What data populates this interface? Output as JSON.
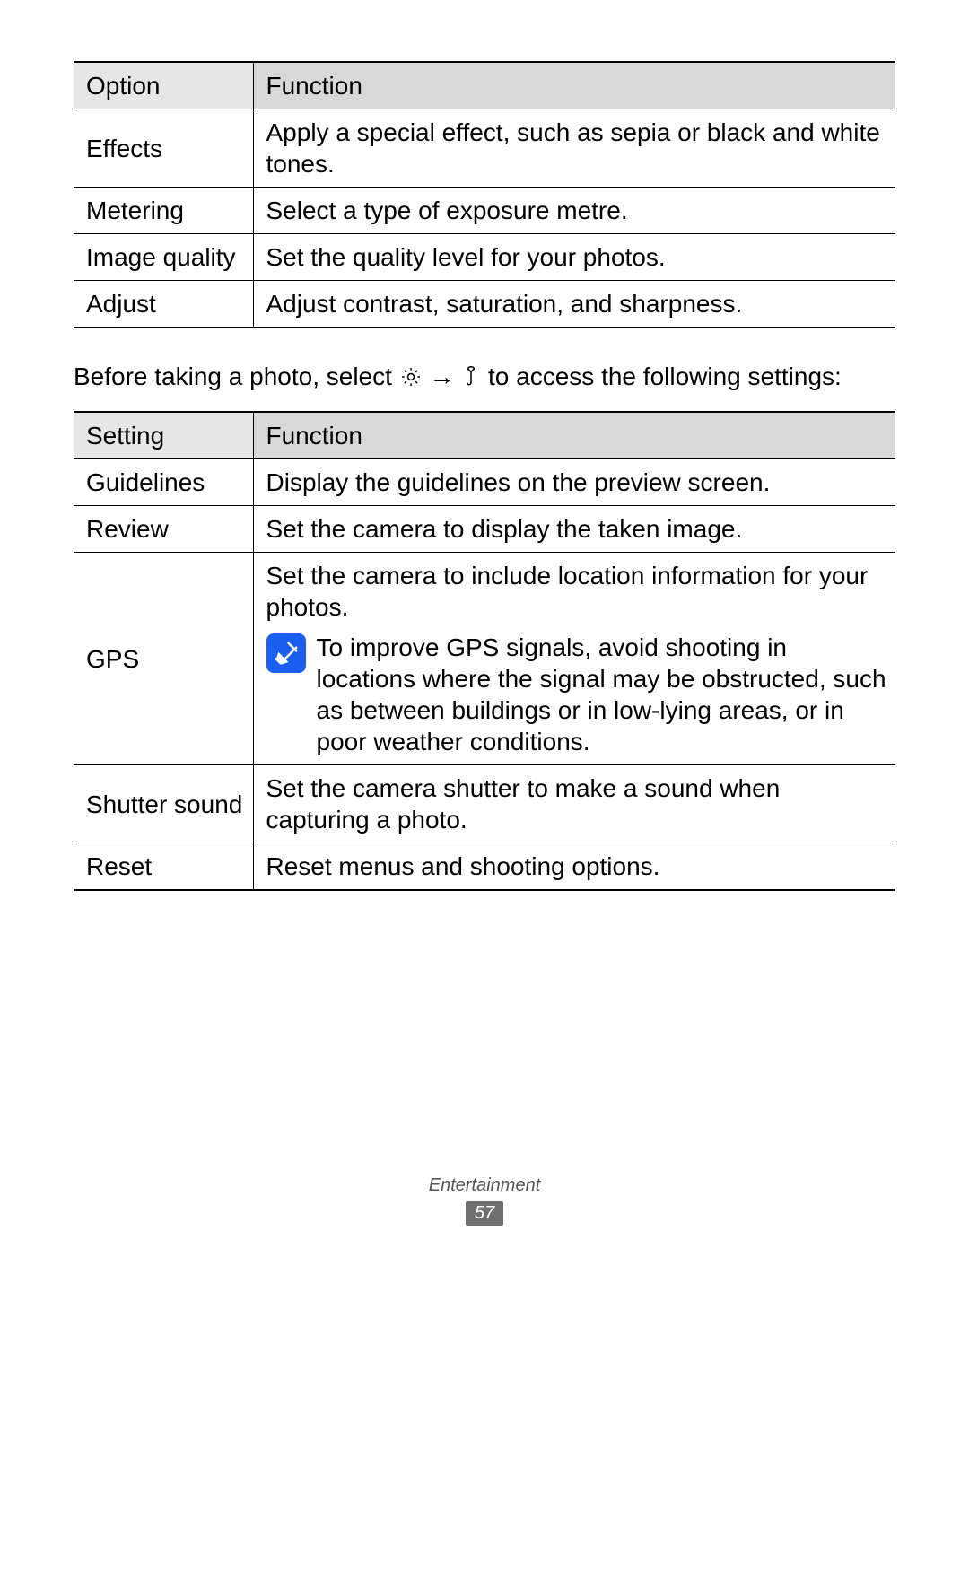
{
  "table1": {
    "header": {
      "col1": "Option",
      "col2": "Function"
    },
    "rows": [
      {
        "opt": "Effects",
        "fn": "Apply a special effect, such as sepia or black and white tones."
      },
      {
        "opt": "Metering",
        "fn": "Select a type of exposure metre."
      },
      {
        "opt": "Image quality",
        "fn": "Set the quality level for your photos."
      },
      {
        "opt": "Adjust",
        "fn": "Adjust contrast, saturation, and sharpness."
      }
    ]
  },
  "mid": {
    "pre": "Before taking a photo, select ",
    "arrow": " → ",
    "post": " to access the following settings:"
  },
  "table2": {
    "header": {
      "col1": "Setting",
      "col2": "Function"
    },
    "rows": {
      "guidelines": {
        "opt": "Guidelines",
        "fn": "Display the guidelines on the preview screen."
      },
      "review": {
        "opt": "Review",
        "fn": "Set the camera to display the taken image."
      },
      "gps": {
        "opt": "GPS",
        "fn": "Set the camera to include location information for your photos.",
        "note": "To improve GPS signals, avoid shooting in locations where the signal may be obstructed, such as between buildings or in low-lying areas, or in poor weather conditions."
      },
      "shutter": {
        "opt": "Shutter sound",
        "fn": "Set the camera shutter to make a sound when capturing a photo."
      },
      "reset": {
        "opt": "Reset",
        "fn": "Reset menus and shooting options."
      }
    }
  },
  "footer": {
    "section": "Entertainment",
    "page": "57"
  }
}
